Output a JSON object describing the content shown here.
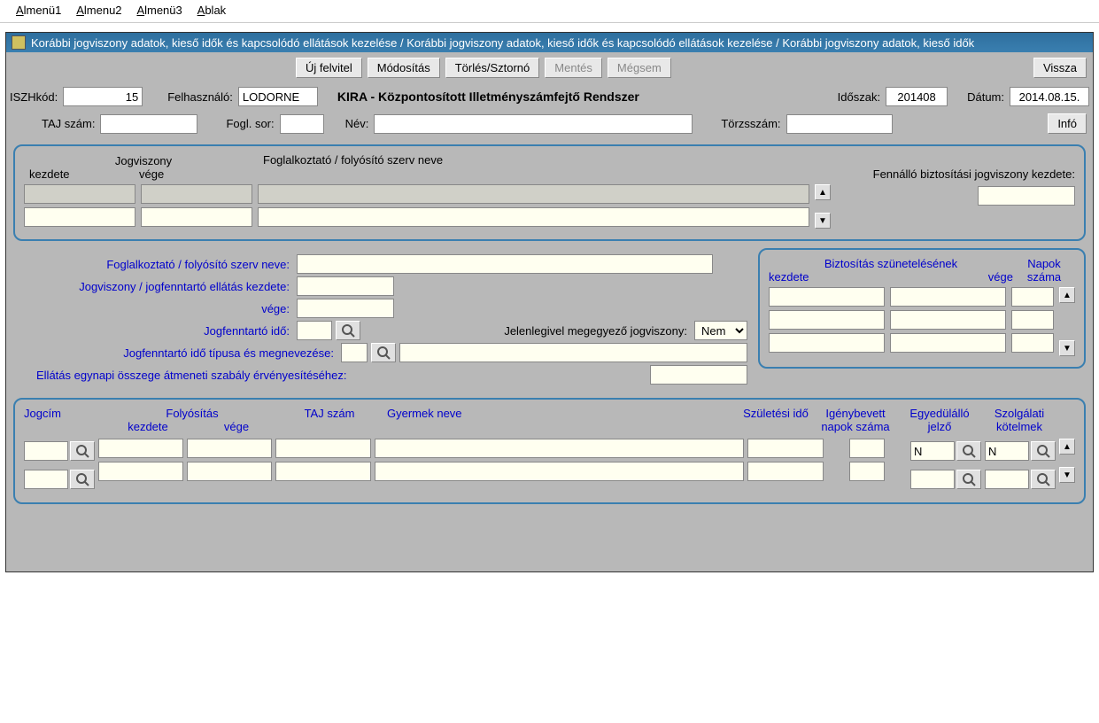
{
  "menu": {
    "items": [
      "Almenü1",
      "Almenu2",
      "Almenü3",
      "Ablak"
    ]
  },
  "window_title": "Korábbi jogviszony adatok, kieső idők és kapcsolódó ellátások kezelése / Korábbi jogviszony adatok, kieső idők és kapcsolódó ellátások kezelése / Korábbi jogviszony adatok, kieső idők",
  "toolbar": {
    "new": "Új felvitel",
    "modify": "Módosítás",
    "delete": "Törlés/Sztornó",
    "save": "Mentés",
    "cancel": "Mégsem",
    "back": "Vissza"
  },
  "header": {
    "iszh_label": "ISZHkód:",
    "iszh_value": "15",
    "user_label": "Felhasználó:",
    "user_value": "LODORNE",
    "system_title": "KIRA - Központosított Illetményszámfejtő Rendszer",
    "period_label": "Időszak:",
    "period_value": "201408",
    "date_label": "Dátum:",
    "date_value": "2014.08.15.",
    "taj_label": "TAJ szám:",
    "taj_value": "",
    "foglsor_label": "Fogl. sor:",
    "foglsor_value": "",
    "nev_label": "Név:",
    "nev_value": "",
    "torzsszam_label": "Törzsszám:",
    "torzsszam_value": "",
    "info": "Infó"
  },
  "jogviszony_panel": {
    "jogviszony_hdr": "Jogviszony",
    "kezdete_hdr": "kezdete",
    "vege_hdr": "vége",
    "folyosito_hdr": "Foglalkoztató / folyósító szerv neve",
    "fennallo_label": "Fennálló biztosítási jogviszony kezdete:",
    "fennallo_value": ""
  },
  "details": {
    "folyosito_label": "Foglalkoztató / folyósító szerv neve:",
    "folyosito_value": "",
    "jogviszony_kezdete_label": "Jogviszony / jogfenntartó ellátás kezdete:",
    "jogviszony_kezdete_value": "",
    "vege_label": "vége:",
    "vege_value": "",
    "jogfenntarto_ido_label": "Jogfenntartó idő:",
    "jogfenntarto_ido_value": "",
    "jelenlegi_label": "Jelenlegivel megegyező jogviszony:",
    "jelenlegi_value": "Nem",
    "jogfenntarto_tipus_label": "Jogfenntartó idő típusa és megnevezése:",
    "jogfenntarto_tipus_code": "",
    "jogfenntarto_tipus_text": "",
    "ellatas_label": "Ellátás egynapi összege átmeneti szabály érvényesítéséhez:",
    "ellatas_value": ""
  },
  "biztositas_panel": {
    "title": "Biztosítás szünetelésének",
    "kezdete_hdr": "kezdete",
    "vege_hdr": "vége",
    "napok_hdr": "Napok száma"
  },
  "bottom_grid": {
    "jogcim_hdr": "Jogcím",
    "folyositas_hdr": "Folyósítás",
    "kezdete_hdr": "kezdete",
    "vege_hdr": "vége",
    "taj_hdr": "TAJ szám",
    "gyermek_hdr": "Gyermek neve",
    "szuletesi_hdr": "Születési idő",
    "igenybevett_hdr": "Igénybevett napok száma",
    "egyed_hdr": "Egyedülálló jelző",
    "szolg_hdr": "Szolgálati kötelmek",
    "rows": [
      {
        "egyed": "N",
        "szolg": "N"
      },
      {
        "egyed": "",
        "szolg": ""
      }
    ]
  }
}
